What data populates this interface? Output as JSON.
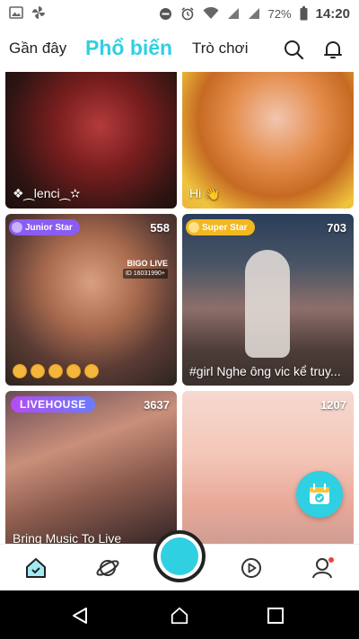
{
  "status_bar": {
    "battery_percent": "72%",
    "time": "14:20",
    "left_icons": [
      "image-icon",
      "pinwheel-icon"
    ],
    "right_icons": [
      "dnd-icon",
      "alarm-icon",
      "wifi-icon",
      "signal-icon",
      "signal-icon",
      "battery-icon"
    ]
  },
  "top_nav": {
    "tabs": [
      {
        "label": "Gần đây",
        "active": false
      },
      {
        "label": "Phổ biến",
        "active": true
      },
      {
        "label": "Trò chơi",
        "active": false
      }
    ],
    "icons": [
      "search-icon",
      "bell-icon"
    ],
    "accent_color": "#2fd0e2"
  },
  "feed": {
    "cards": [
      {
        "caption": "❖⁔lenci⁔✫",
        "viewers": "",
        "badge": ""
      },
      {
        "caption": "Hi 👋",
        "viewers": "",
        "badge": ""
      },
      {
        "caption": "",
        "viewers": "558",
        "badge": "Junior Star",
        "overlay": {
          "brand": "BIGO LIVE",
          "id": "ID 16031990+"
        }
      },
      {
        "caption": "#girl Nghe ông vic kể truy...",
        "viewers": "703",
        "badge": "Super Star"
      },
      {
        "caption": "Bring Music To Live",
        "viewers": "3637",
        "badge": "LIVEHOUSE"
      },
      {
        "caption": "",
        "viewers": "1207",
        "badge": ""
      }
    ]
  },
  "fab": {
    "icon": "calendar-check-icon"
  },
  "bottom_bar": {
    "items": [
      "home-icon",
      "explore-planet-icon",
      "go-live-button",
      "video-play-icon",
      "profile-icon"
    ]
  },
  "system_nav": {
    "items": [
      "back-icon",
      "home-icon",
      "recents-icon"
    ]
  }
}
